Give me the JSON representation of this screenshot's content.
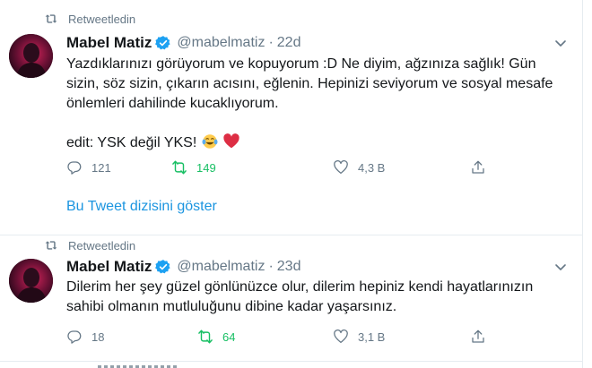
{
  "tweets": [
    {
      "retweet_label": "Retweetledin",
      "name": "Mabel Matiz",
      "handle": "@mabelmatiz",
      "separator": "·",
      "time": "22d",
      "lines": [
        "Yazdıklarınızı görüyorum ve kopuyorum :D Ne diyim, ağzınıza sağlık! Gün",
        "sizin, söz sizin, çıkarın acısını, eğlenin. Hepinizi seviyorum ve sosyal mesafe",
        "önlemleri dahilinde kucaklıyorum."
      ],
      "edit_line": "edit: YSK değil YKS!",
      "emojis": [
        "face-with-tears-of-joy",
        "red-heart"
      ],
      "replies": "121",
      "retweets": "149",
      "likes": "4,3 B",
      "show_thread": "Bu Tweet dizisini göster"
    },
    {
      "retweet_label": "Retweetledin",
      "name": "Mabel Matiz",
      "handle": "@mabelmatiz",
      "separator": "·",
      "time": "23d",
      "lines": [
        "Dilerim her şey güzel gönlünüzce olur, dilerim hepiniz kendi hayatlarınızın",
        "sahibi olmanın mutluluğunu dibine kadar yaşarsınız."
      ],
      "replies": "18",
      "retweets": "64",
      "likes": "3,1 B"
    }
  ],
  "colors": {
    "accent": "#1da1f2",
    "link": "#1b95e0",
    "retweet_green": "#17bf63",
    "muted": "#657786",
    "text": "#14171a",
    "divider": "#e6ecf0"
  },
  "icons": {
    "retweet": "retweet-icon",
    "verified": "verified-badge-icon",
    "reply": "reply-icon",
    "like": "heart-icon",
    "share": "share-icon",
    "caret": "chevron-down-icon"
  }
}
